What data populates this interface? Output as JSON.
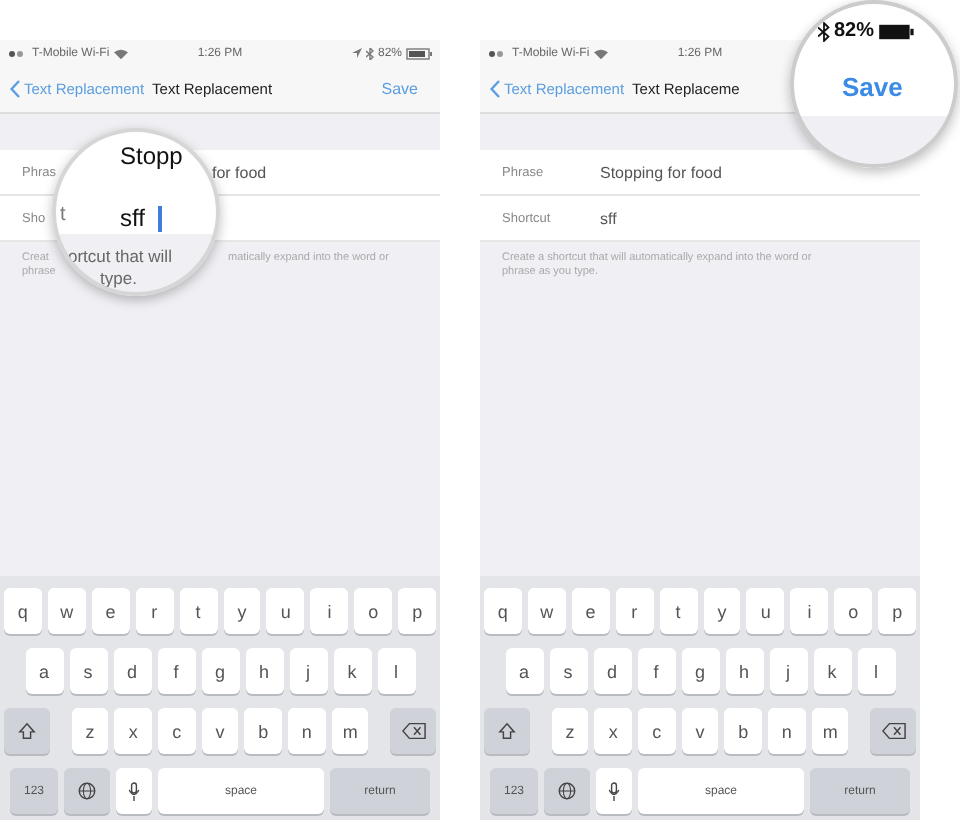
{
  "panels": [
    {
      "status_bar": {
        "carrier": "T-Mobile Wi-Fi",
        "time": "1:26 PM",
        "battery": "82%"
      },
      "nav": {
        "back": "Text Replacement",
        "title": "Text Replacement",
        "save": "Save"
      },
      "rows": [
        {
          "label": "Phras",
          "value": "for food"
        },
        {
          "label": "Sho"
        }
      ],
      "footer_lines": [
        [
          "Creat",
          "matically expand into the word or"
        ],
        [
          "phrase"
        ]
      ],
      "lens": {
        "kind": "field",
        "phrase": "Stopp",
        "label_fragment": "t",
        "shortcut": "sff",
        "cursor": true,
        "hint_lines": [
          "ortcut that will",
          "type."
        ]
      },
      "keyboard": [
        [
          {
            "kind": "letter",
            "label": "q"
          },
          {
            "kind": "letter",
            "label": "w"
          },
          {
            "kind": "letter",
            "label": "e"
          },
          {
            "kind": "letter",
            "label": "r"
          },
          {
            "kind": "letter",
            "label": "t"
          },
          {
            "kind": "letter",
            "label": "y"
          },
          {
            "kind": "letter",
            "label": "u"
          },
          {
            "kind": "letter",
            "label": "i"
          },
          {
            "kind": "letter",
            "label": "o"
          },
          {
            "kind": "letter",
            "label": "p"
          }
        ],
        [
          {
            "kind": "letter",
            "label": "a"
          },
          {
            "kind": "letter",
            "label": "s"
          },
          {
            "kind": "letter",
            "label": "d"
          },
          {
            "kind": "letter",
            "label": "f"
          },
          {
            "kind": "letter",
            "label": "g"
          },
          {
            "kind": "letter",
            "label": "h"
          },
          {
            "kind": "letter",
            "label": "j"
          },
          {
            "kind": "letter",
            "label": "k"
          },
          {
            "kind": "letter",
            "label": "l"
          }
        ],
        [
          {
            "kind": "shift"
          },
          {
            "kind": "letter",
            "label": "z"
          },
          {
            "kind": "letter",
            "label": "x"
          },
          {
            "kind": "letter",
            "label": "c"
          },
          {
            "kind": "letter",
            "label": "v"
          },
          {
            "kind": "letter",
            "label": "b"
          },
          {
            "kind": "letter",
            "label": "n"
          },
          {
            "kind": "letter",
            "label": "m"
          },
          {
            "kind": "delete"
          }
        ],
        [
          {
            "kind": "numbers",
            "label": "123"
          },
          {
            "kind": "globe"
          },
          {
            "kind": "mic"
          },
          {
            "kind": "space",
            "label": "space"
          },
          {
            "kind": "return",
            "label": "return"
          }
        ]
      ]
    },
    {
      "status_bar": {
        "carrier": "T-Mobile Wi-Fi",
        "time": "1:26 PM"
      },
      "nav": {
        "back": "Text Replacement",
        "title": "Text Replaceme"
      },
      "rows": [
        {
          "label": "Phrase",
          "value": "Stopping for food"
        },
        {
          "label": "Shortcut",
          "value": "sff"
        }
      ],
      "footer_lines": [
        [
          "Create a shortcut that will automatically expand into the word or"
        ],
        [
          "phrase as you type."
        ]
      ],
      "lens": {
        "kind": "status",
        "battery": "82%",
        "save": "Save"
      },
      "keyboard": [
        [
          {
            "kind": "letter",
            "label": "q"
          },
          {
            "kind": "letter",
            "label": "w"
          },
          {
            "kind": "letter",
            "label": "e"
          },
          {
            "kind": "letter",
            "label": "r"
          },
          {
            "kind": "letter",
            "label": "t"
          },
          {
            "kind": "letter",
            "label": "y"
          },
          {
            "kind": "letter",
            "label": "u"
          },
          {
            "kind": "letter",
            "label": "i"
          },
          {
            "kind": "letter",
            "label": "o"
          },
          {
            "kind": "letter",
            "label": "p"
          }
        ],
        [
          {
            "kind": "letter",
            "label": "a"
          },
          {
            "kind": "letter",
            "label": "s"
          },
          {
            "kind": "letter",
            "label": "d"
          },
          {
            "kind": "letter",
            "label": "f"
          },
          {
            "kind": "letter",
            "label": "g"
          },
          {
            "kind": "letter",
            "label": "h"
          },
          {
            "kind": "letter",
            "label": "j"
          },
          {
            "kind": "letter",
            "label": "k"
          },
          {
            "kind": "letter",
            "label": "l"
          }
        ],
        [
          {
            "kind": "shift"
          },
          {
            "kind": "letter",
            "label": "z"
          },
          {
            "kind": "letter",
            "label": "x"
          },
          {
            "kind": "letter",
            "label": "c"
          },
          {
            "kind": "letter",
            "label": "v"
          },
          {
            "kind": "letter",
            "label": "b"
          },
          {
            "kind": "letter",
            "label": "n"
          },
          {
            "kind": "letter",
            "label": "m"
          },
          {
            "kind": "delete"
          }
        ],
        [
          {
            "kind": "numbers",
            "label": "123"
          },
          {
            "kind": "globe"
          },
          {
            "kind": "mic"
          },
          {
            "kind": "space",
            "label": "space"
          },
          {
            "kind": "return",
            "label": "return"
          }
        ]
      ]
    }
  ]
}
